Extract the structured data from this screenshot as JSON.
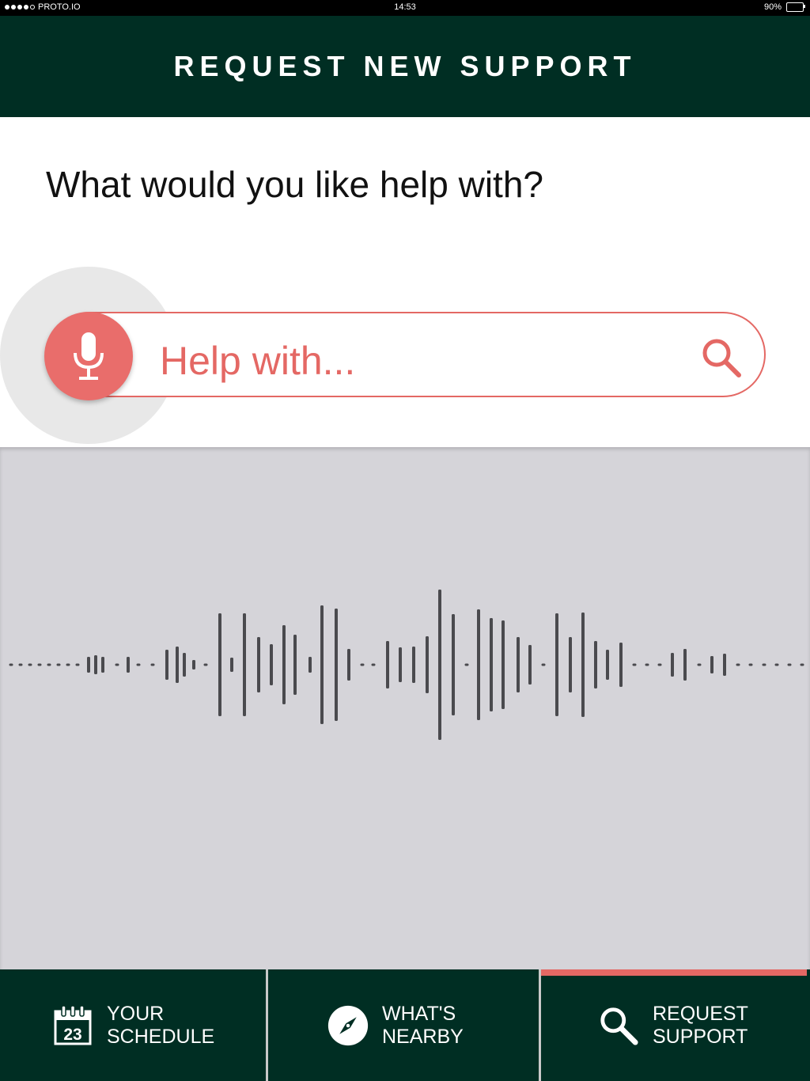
{
  "status_bar": {
    "carrier": "PROTO.IO",
    "time": "14:53",
    "battery": "90%"
  },
  "header": {
    "title": "REQUEST NEW SUPPORT"
  },
  "question": "What would you like help with?",
  "search": {
    "placeholder": "Help with...",
    "mic_icon": "microphone-icon",
    "search_icon": "search-icon"
  },
  "colors": {
    "header_bg": "#002e23",
    "accent": "#e46864",
    "wave_bg": "#d5d4d9",
    "waveform": "#4a4a4e"
  },
  "tabs": [
    {
      "icon": "calendar-icon",
      "icon_text": "23",
      "label": "YOUR\nSCHEDULE",
      "active": false
    },
    {
      "icon": "compass-icon",
      "label": "WHAT'S\nNEARBY",
      "active": false
    },
    {
      "icon": "search-icon",
      "label": "REQUEST\nSUPPORT",
      "active": true
    }
  ]
}
